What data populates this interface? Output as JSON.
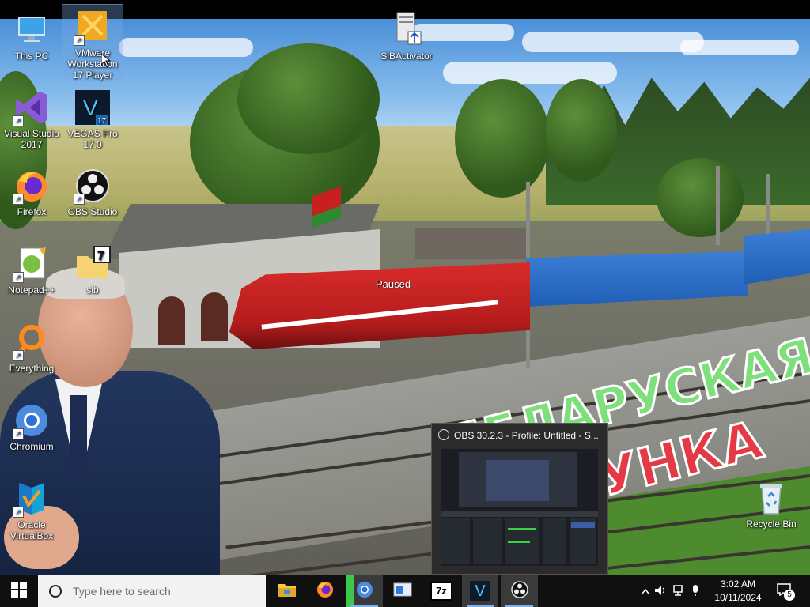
{
  "desktop": {
    "icons": [
      {
        "label": "This PC"
      },
      {
        "label": "VMware Workstation 17 Player"
      },
      {
        "label": "SiBActivator"
      },
      {
        "label": "Visual Studio 2017"
      },
      {
        "label": "VEGAS Pro 17.0"
      },
      {
        "label": "Firefox"
      },
      {
        "label": "OBS Studio"
      },
      {
        "label": "Notepad++"
      },
      {
        "label": "sib"
      },
      {
        "label": "Everything"
      },
      {
        "label": "Chromium"
      },
      {
        "label": "Oracle VirtualBox"
      },
      {
        "label": "Recycle Bin"
      }
    ],
    "wallpaper": {
      "overlay_status": "Paused",
      "banner_line1": "БЕЛАРУСКАЯ",
      "banner_line2": "ЧУГУНКА"
    }
  },
  "obs_preview": {
    "title": "OBS 30.2.3 - Profile: Untitled - S..."
  },
  "taskbar": {
    "start_icon": "windows-logo-icon",
    "search_placeholder": "Type here to search",
    "pinned": [
      {
        "name": "file-explorer"
      },
      {
        "name": "firefox"
      },
      {
        "name": "chromium"
      },
      {
        "name": "remote-app"
      },
      {
        "name": "7zip",
        "label": "7z"
      },
      {
        "name": "vegas-pro",
        "label": "V"
      },
      {
        "name": "obs-studio"
      }
    ],
    "clock": {
      "time": "3:02 AM",
      "date": "10/11/2024"
    },
    "notification_count": "5"
  },
  "colors": {
    "taskbar": "#101010",
    "accent": "#7fb0e8",
    "search_bg": "#f2f2f2"
  }
}
